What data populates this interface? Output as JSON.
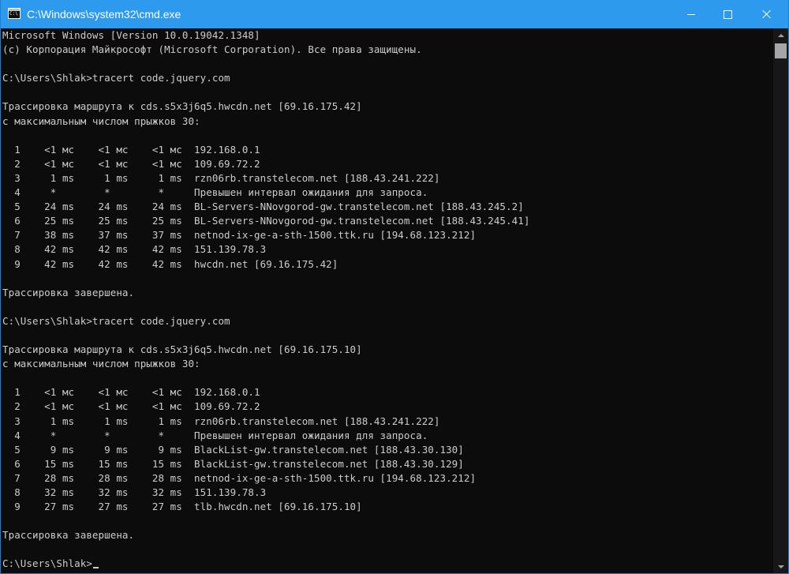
{
  "window": {
    "title": "C:\\Windows\\system32\\cmd.exe",
    "accent_color": "#2d9aee",
    "background_color": "#0c0c0c",
    "text_color": "#cccccc"
  },
  "controls": {
    "minimize_icon": "minimize-icon",
    "maximize_icon": "maximize-icon",
    "close_icon": "close-icon"
  },
  "console": {
    "lines": [
      "Microsoft Windows [Version 10.0.19042.1348]",
      "(c) Корпорация Майкрософт (Microsoft Corporation). Все права защищены.",
      "",
      "C:\\Users\\Shlak>tracert code.jquery.com",
      "",
      "Трассировка маршрута к cds.s5x3j6q5.hwcdn.net [69.16.175.42]",
      "с максимальным числом прыжков 30:",
      "",
      "  1    <1 мс    <1 мс    <1 мс  192.168.0.1",
      "  2    <1 мс    <1 мс    <1 мс  109.69.72.2",
      "  3     1 ms     1 ms     1 ms  rzn06rb.transtelecom.net [188.43.241.222]",
      "  4     *        *        *     Превышен интервал ожидания для запроса.",
      "  5    24 ms    24 ms    24 ms  BL-Servers-NNovgorod-gw.transtelecom.net [188.43.245.2]",
      "  6    25 ms    25 ms    25 ms  BL-Servers-NNovgorod-gw.transtelecom.net [188.43.245.41]",
      "  7    38 ms    37 ms    37 ms  netnod-ix-ge-a-sth-1500.ttk.ru [194.68.123.212]",
      "  8    42 ms    42 ms    42 ms  151.139.78.3",
      "  9    42 ms    42 ms    42 ms  hwcdn.net [69.16.175.42]",
      "",
      "Трассировка завершена.",
      "",
      "C:\\Users\\Shlak>tracert code.jquery.com",
      "",
      "Трассировка маршрута к cds.s5x3j6q5.hwcdn.net [69.16.175.10]",
      "с максимальным числом прыжков 30:",
      "",
      "  1    <1 мс    <1 мс    <1 мс  192.168.0.1",
      "  2    <1 мс    <1 мс    <1 мс  109.69.72.2",
      "  3     1 ms     1 ms     1 ms  rzn06rb.transtelecom.net [188.43.241.222]",
      "  4     *        *        *     Превышен интервал ожидания для запроса.",
      "  5     9 ms     9 ms     9 ms  BlackList-gw.transtelecom.net [188.43.30.130]",
      "  6    15 ms    15 ms    15 ms  BlackList-gw.transtelecom.net [188.43.30.129]",
      "  7    28 ms    28 ms    28 ms  netnod-ix-ge-a-sth-1500.ttk.ru [194.68.123.212]",
      "  8    32 ms    32 ms    32 ms  151.139.78.3",
      "  9    27 ms    27 ms    27 ms  tlb.hwcdn.net [69.16.175.10]",
      "",
      "Трассировка завершена.",
      "",
      "C:\\Users\\Shlak>"
    ]
  },
  "scrollbar": {
    "up_icon": "scroll-up-arrow-icon",
    "down_icon": "scroll-down-arrow-icon"
  }
}
